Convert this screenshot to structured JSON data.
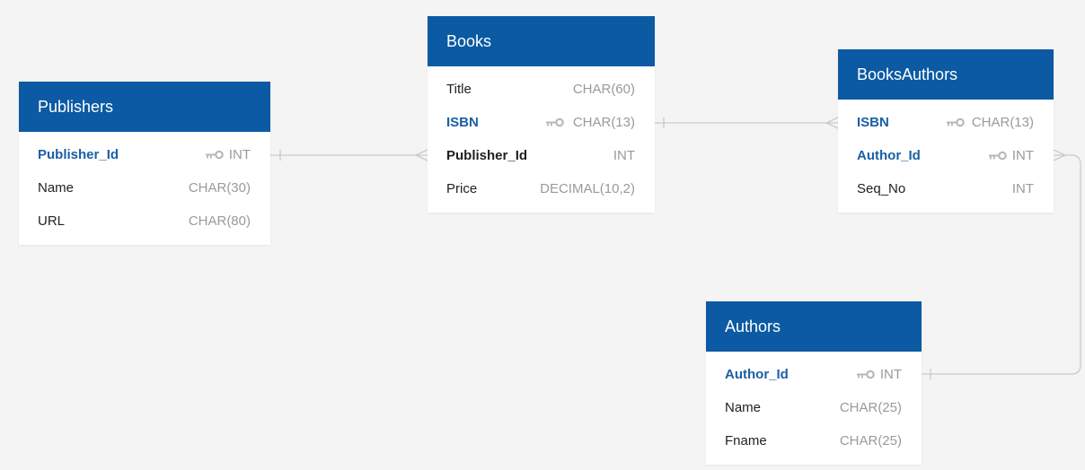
{
  "colors": {
    "background": "#f3f4f3",
    "header": "#0b5aa3",
    "primary_key_text": "#1a5fa6",
    "type_text": "#9a9a9a",
    "connector": "#c7cbd2"
  },
  "tables": {
    "publishers": {
      "title": "Publishers",
      "columns": [
        {
          "name": "Publisher_Id",
          "type": "INT",
          "key": "primary"
        },
        {
          "name": "Name",
          "type": "CHAR(30)"
        },
        {
          "name": "URL",
          "type": "CHAR(80)"
        }
      ]
    },
    "books": {
      "title": "Books",
      "columns": [
        {
          "name": "Title",
          "type": "CHAR(60)"
        },
        {
          "name": "ISBN",
          "type": "CHAR(13)",
          "key": "primary"
        },
        {
          "name": "Publisher_Id",
          "type": "INT",
          "key": "foreign"
        },
        {
          "name": "Price",
          "type": "DECIMAL(10,2)"
        }
      ]
    },
    "books_authors": {
      "title": "BooksAuthors",
      "columns": [
        {
          "name": "ISBN",
          "type": "CHAR(13)",
          "key": "primary"
        },
        {
          "name": "Author_Id",
          "type": "INT",
          "key": "primary"
        },
        {
          "name": "Seq_No",
          "type": "INT"
        }
      ]
    },
    "authors": {
      "title": "Authors",
      "columns": [
        {
          "name": "Author_Id",
          "type": "INT",
          "key": "primary"
        },
        {
          "name": "Name",
          "type": "CHAR(25)"
        },
        {
          "name": "Fname",
          "type": "CHAR(25)"
        }
      ]
    }
  },
  "relationships": [
    {
      "from": "Publishers.Publisher_Id",
      "to": "Books.Publisher_Id",
      "cardinality": "one-to-many"
    },
    {
      "from": "Books.ISBN",
      "to": "BooksAuthors.ISBN",
      "cardinality": "one-to-many"
    },
    {
      "from": "Authors.Author_Id",
      "to": "BooksAuthors.Author_Id",
      "cardinality": "one-to-many"
    }
  ]
}
